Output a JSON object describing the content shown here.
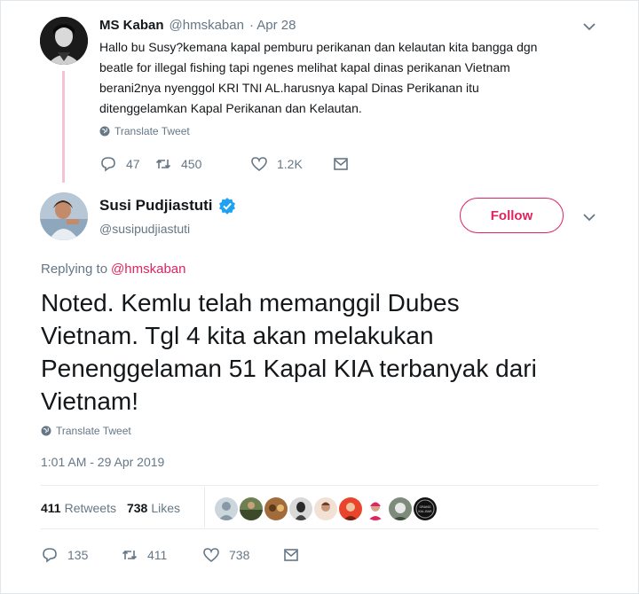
{
  "reply_tweet": {
    "name": "MS Kaban",
    "handle": "@hmskaban",
    "date": "· Apr 28",
    "text_lines": [
      "Hallo bu Susy?kemana kapal pemburu perikanan dan kelautan kita bangga dgn",
      "beatle for illegal fishing tapi ngenes melihat kapal dinas perikanan Vietnam",
      "berani2nya nyenggol KRI TNI AL.harusnya kapal Dinas Perikanan itu",
      "ditenggelamkan   Kapal Perikanan dan Kelautan."
    ],
    "translate": "Translate Tweet",
    "replies": "47",
    "retweets": "450",
    "likes": "1.2K"
  },
  "main_tweet": {
    "name": "Susi Pudjiastuti",
    "handle": "@susipudjiastuti",
    "follow_label": "Follow",
    "replying_prefix": "Replying to",
    "replying_handle": "@hmskaban",
    "text_lines": [
      "Noted. Kemlu telah memanggil Dubes",
      "Vietnam. Tgl 4 kita akan melakukan",
      "Penenggelaman 51 Kapal KIA terbanyak dari",
      "Vietnam!"
    ],
    "translate": "Translate Tweet",
    "timestamp": "1:01 AM - 29 Apr 2019",
    "retweet_count": "411",
    "retweet_label": "Retweets",
    "like_count": "738",
    "like_label": "Likes",
    "liker_badge_text": "ORANG KAL-BAR",
    "replies": "135",
    "retweets": "411",
    "likes": "738"
  },
  "colors": {
    "accent": "#e0245e",
    "verified": "#1da1f2",
    "muted": "#657786",
    "text": "#14171a"
  },
  "icons": [
    "chevron-down-icon",
    "globe-icon",
    "reply-icon",
    "retweet-icon",
    "like-icon",
    "message-icon",
    "verified-badge-icon"
  ]
}
